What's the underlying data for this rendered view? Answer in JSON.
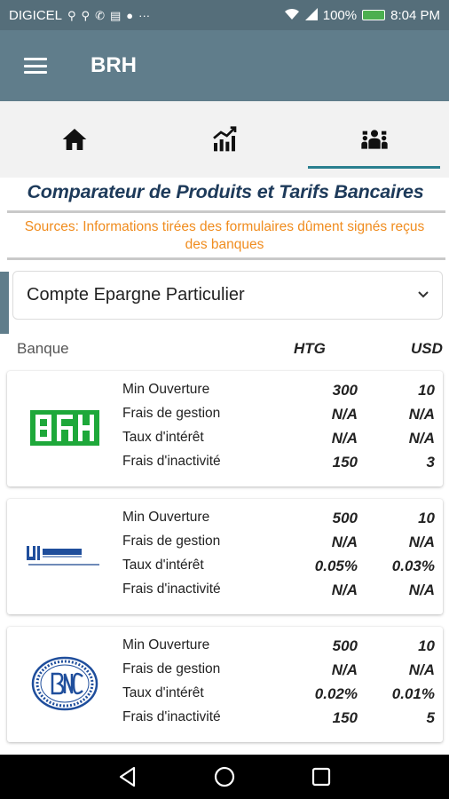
{
  "status_bar": {
    "carrier": "DIGICEL",
    "battery": "100%",
    "time": "8:04 PM",
    "icons": [
      "usb-icon",
      "usb-icon",
      "call-icon",
      "clipboard-icon",
      "message-icon",
      "more-icon",
      "wifi-icon",
      "signal-icon",
      "battery-icon"
    ]
  },
  "app_bar": {
    "title": "BRH",
    "menu_icon": "hamburger-icon"
  },
  "tabs": [
    {
      "icon": "home-icon",
      "active": false
    },
    {
      "icon": "chart-icon",
      "active": false
    },
    {
      "icon": "people-compare-icon",
      "active": true
    }
  ],
  "page": {
    "title": "Comparateur de Produits et Tarifs Bancaires",
    "sources": "Sources: Informations tirées des formulaires dûment signés reçus des banques",
    "selected_product": "Compte Epargne Particulier"
  },
  "columns": {
    "bank": "Banque",
    "htg": "HTG",
    "usd": "USD"
  },
  "banks": [
    {
      "logo": "brh-logo",
      "rows": [
        {
          "label": "Min Ouverture",
          "htg": "300",
          "usd": "10"
        },
        {
          "label": "Frais de gestion",
          "htg": "N/A",
          "usd": "N/A"
        },
        {
          "label": "Taux d'intérêt",
          "htg": "N/A",
          "usd": "N/A"
        },
        {
          "label": "Frais d'inactivité",
          "htg": "150",
          "usd": "3"
        }
      ]
    },
    {
      "logo": "unibank-logo",
      "rows": [
        {
          "label": "Min Ouverture",
          "htg": "500",
          "usd": "10"
        },
        {
          "label": "Frais de gestion",
          "htg": "N/A",
          "usd": "N/A"
        },
        {
          "label": "Taux d'intérêt",
          "htg": "0.05%",
          "usd": "0.03%"
        },
        {
          "label": "Frais d'inactivité",
          "htg": "N/A",
          "usd": "N/A"
        }
      ]
    },
    {
      "logo": "bnc-logo",
      "rows": [
        {
          "label": "Min Ouverture",
          "htg": "500",
          "usd": "10"
        },
        {
          "label": "Frais de gestion",
          "htg": "N/A",
          "usd": "N/A"
        },
        {
          "label": "Taux d'intérêt",
          "htg": "0.02%",
          "usd": "0.01%"
        },
        {
          "label": "Frais d'inactivité",
          "htg": "150",
          "usd": "5"
        }
      ]
    }
  ],
  "colors": {
    "app_bar": "#607d8b",
    "status_bar": "#556e7a",
    "title": "#1d3a5a",
    "sources": "#f08c1e",
    "tab_indicator": "#2a7f8f"
  }
}
